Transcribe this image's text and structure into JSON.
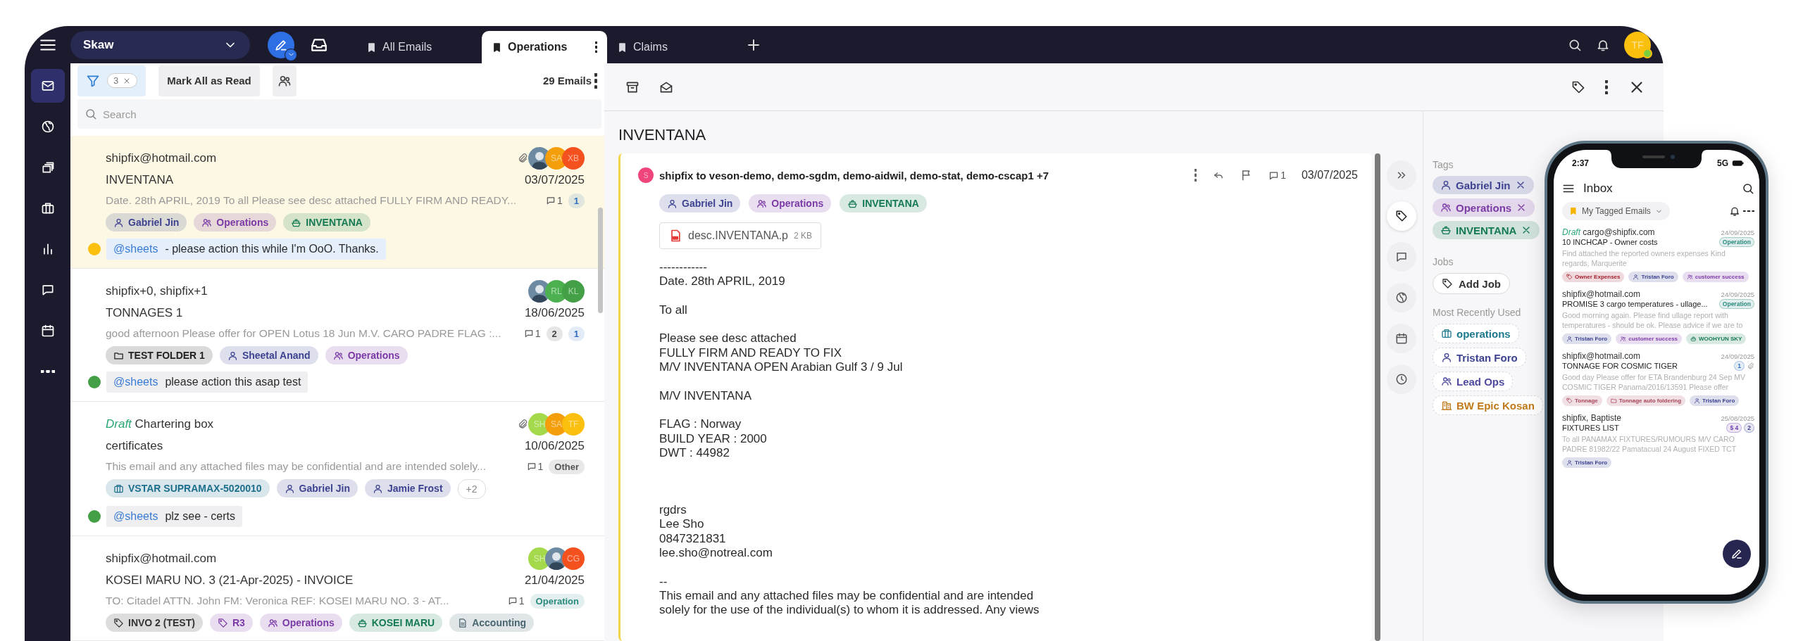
{
  "top_bar": {
    "workspace": "Skaw",
    "tabs": [
      {
        "label": "All Emails",
        "selected": false
      },
      {
        "label": "Operations",
        "selected": true
      },
      {
        "label": "Claims",
        "selected": false
      }
    ],
    "avatar": {
      "initials": "TF",
      "color": "#fbbf0e",
      "online": true
    }
  },
  "rail": {
    "items": [
      {
        "selected": true
      },
      {
        "selected": false
      },
      {
        "selected": false
      },
      {
        "selected": false
      },
      {
        "selected": false
      },
      {
        "selected": false
      },
      {
        "selected": false
      },
      {
        "selected": false
      }
    ]
  },
  "list": {
    "filter_count": "3",
    "mark_all": "Mark All as Read",
    "count": "29 Emails",
    "search": {
      "placeholder": "Search"
    },
    "emails": [
      {
        "selected": true,
        "from": "shipfix@hotmail.com",
        "attachment": true,
        "avatars": [
          {
            "kind": "photo"
          },
          {
            "kind": "initials",
            "initials": "SA",
            "color": "#f59e0b"
          },
          {
            "kind": "initials",
            "initials": "XB",
            "color": "#f4511e"
          }
        ],
        "subject": "INVENTANA",
        "date": "03/07/2025",
        "preview": "Date. 28th APRIL, 2019 To all Please see desc attached FULLY FIRM AND READY...",
        "comments": "1",
        "badges": [
          {
            "text": "1",
            "color": "#2f6fbd"
          }
        ],
        "tags": [
          {
            "kind": "person",
            "text": "Gabriel Jin",
            "color": "#3d4291"
          },
          {
            "kind": "group",
            "text": "Operations",
            "color": "#7b3aa6"
          },
          {
            "kind": "vessel",
            "text": "INVENTANA",
            "color": "#157a52"
          }
        ],
        "note": {
          "avatar": {
            "color": "#fbbf0e"
          },
          "mention": "@sheets",
          "text": "- please action this while I'm OoO. Thanks."
        }
      },
      {
        "selected": false,
        "from": "shipfix+0, shipfix+1",
        "attachment": false,
        "avatars": [
          {
            "kind": "photo"
          },
          {
            "kind": "initials",
            "initials": "RL",
            "color": "#4caf50"
          },
          {
            "kind": "initials",
            "initials": "KL",
            "color": "#43a047"
          }
        ],
        "subject": "TONNAGES 1",
        "date": "18/06/2025",
        "preview": "good afternoon Please offer for OPEN Lotus 18 Jun M.V. CARO PADRE FLAG :...",
        "comments": "1",
        "badges": [
          {
            "text": "2",
            "color": "#444444"
          },
          {
            "text": "1",
            "color": "#2f6fbd"
          }
        ],
        "tags": [
          {
            "kind": "folder",
            "text": "TEST FOLDER 1",
            "color": "#222222"
          },
          {
            "kind": "person",
            "text": "Sheetal Anand",
            "color": "#3d4291"
          },
          {
            "kind": "group",
            "text": "Operations",
            "color": "#7b3aa6"
          }
        ],
        "note": {
          "avatar": {
            "color": "#43a047"
          },
          "mention": "@sheets",
          "text": "please action this asap test"
        }
      },
      {
        "selected": false,
        "draft": "Draft",
        "from": "Chartering box",
        "attachment": true,
        "avatars": [
          {
            "kind": "initials",
            "initials": "SH",
            "color": "#a3d94a"
          },
          {
            "kind": "initials",
            "initials": "SA",
            "color": "#f59e0b"
          },
          {
            "kind": "initials",
            "initials": "TF",
            "color": "#fbbf0e"
          }
        ],
        "subject": "certificates",
        "date": "10/06/2025",
        "preview": "This email and any attached files may be confidential and are intended solely...",
        "comments": "1",
        "badges": [
          {
            "text": "Other",
            "color": "#555555"
          }
        ],
        "tags": [
          {
            "kind": "job",
            "text": "VSTAR SUPRAMAX-5020010",
            "color": "#1d6f8c"
          },
          {
            "kind": "person",
            "text": "Gabriel Jin",
            "color": "#3d4291"
          },
          {
            "kind": "person",
            "text": "Jamie Frost",
            "color": "#3d4291"
          },
          {
            "kind": "more",
            "text": "+2",
            "color": "#888888"
          }
        ],
        "note": {
          "avatar": {
            "color": "#43a047"
          },
          "mention": "@sheets",
          "text": "plz see - certs"
        }
      },
      {
        "selected": false,
        "from": "shipfix@hotmail.com",
        "attachment": false,
        "avatars": [
          {
            "kind": "initials",
            "initials": "SH",
            "color": "#a3d94a"
          },
          {
            "kind": "photo"
          },
          {
            "kind": "initials",
            "initials": "CG",
            "color": "#f4511e"
          }
        ],
        "subject": "KOSEI MARU NO. 3 (21-Apr-2025) - INVOICE",
        "date": "21/04/2025",
        "preview": "TO: Citadel ATTN. John FM: Veronica REF: KOSEI MARU NO. 3 - AT...",
        "comments": "1",
        "badges": [
          {
            "text": "Operation",
            "color": "#2a8a7e"
          }
        ],
        "tags": [
          {
            "kind": "label",
            "text": "INVO 2 (TEST)",
            "color": "#333333"
          },
          {
            "kind": "label",
            "text": "R3",
            "color": "#7b3aa6"
          },
          {
            "kind": "group",
            "text": "Operations",
            "color": "#7b3aa6"
          },
          {
            "kind": "vessel",
            "text": "KOSEI MARU",
            "color": "#157a52"
          },
          {
            "kind": "doc",
            "text": "Accounting",
            "color": "#4a6670"
          }
        ]
      }
    ]
  },
  "reader": {
    "subject": "INVENTANA",
    "message": {
      "avatar": {
        "initial": "S",
        "color": "#f0457a"
      },
      "header": "shipfix to veson-demo, demo-sgdm, demo-aidwil, demo-stat, demo-cscap1 +7",
      "comments": "1",
      "date": "03/07/2025",
      "tags": [
        {
          "kind": "person",
          "text": "Gabriel Jin",
          "color": "#3d4291"
        },
        {
          "kind": "group",
          "text": "Operations",
          "color": "#7b3aa6"
        },
        {
          "kind": "vessel",
          "text": "INVENTANA",
          "color": "#157a52"
        }
      ],
      "attachment": {
        "name": "desc.INVENTANA.p",
        "size": "2 KB"
      },
      "body": [
        {
          "spaced": false,
          "lines": [
            "------------",
            "Date. 28th APRIL, 2019"
          ]
        },
        {
          "spaced": false,
          "lines": [
            "To all"
          ]
        },
        {
          "spaced": false,
          "lines": [
            "Please see desc attached",
            "FULLY FIRM AND READY TO FIX",
            "M/V INVENTANA OPEN Arabian Gulf 3 / 9 Jul"
          ]
        },
        {
          "spaced": false,
          "lines": [
            "M/V INVENTANA"
          ]
        },
        {
          "spaced": false,
          "lines": [
            "FLAG : Norway",
            "BUILD YEAR : 2000",
            "DWT : 44982"
          ]
        },
        {
          "spaced": true,
          "lines": [
            "rgdrs",
            "Lee Sho",
            "0847321831",
            "lee.sho@notreal.com"
          ]
        },
        {
          "spaced": false,
          "lines": [
            "--",
            "This email and any attached files may be confidential and are intended",
            "solely for the use of the individual(s) to whom it is addressed. Any views"
          ]
        }
      ]
    },
    "side_buttons": [
      {
        "selected": false
      },
      {
        "selected": true
      },
      {
        "selected": false
      },
      {
        "selected": false
      },
      {
        "selected": false
      },
      {
        "selected": false
      }
    ]
  },
  "panel": {
    "tags_heading": "Tags",
    "tags": [
      {
        "kind": "person",
        "text": "Gabriel Jin",
        "color": "#3d4291"
      },
      {
        "kind": "group",
        "text": "Operations",
        "color": "#7b3aa6"
      },
      {
        "kind": "vessel",
        "text": "INVENTANA",
        "color": "#157a52"
      }
    ],
    "jobs_heading": "Jobs",
    "add_job": "Add Job",
    "recent_heading": "Most Recently Used",
    "recent": [
      {
        "kind": "job",
        "text": "operations",
        "color": "#1d7a8c"
      },
      {
        "kind": "person",
        "text": "Tristan Foro",
        "color": "#3d4291"
      },
      {
        "kind": "group",
        "text": "Lead Ops",
        "color": "#4f4aa0"
      },
      {
        "kind": "company",
        "text": "BW Epic Kosan",
        "color": "#c07a1a"
      }
    ]
  },
  "phone": {
    "time": "2:37",
    "network": "5G",
    "title": "Inbox",
    "filter": "My Tagged Emails",
    "emails": [
      {
        "draft": "Draft",
        "from": "cargo@shipfix.com",
        "date": "24/09/2025",
        "subject": "10 INCHCAP - Owner costs",
        "attachment": false,
        "badges": [
          {
            "text": "Operation",
            "color": "#2a8a7e"
          }
        ],
        "preview": "Find attached the reported owners expenses Kind regards, Marquerite",
        "tags": [
          {
            "kind": "label",
            "text": "Owner Expenses",
            "color": "#a3202f"
          },
          {
            "kind": "person",
            "text": "Tristan Foro",
            "color": "#3d4291"
          },
          {
            "kind": "group",
            "text": "customer success",
            "color": "#7b3aa6"
          }
        ]
      },
      {
        "from": "shipfix@hotmail.com",
        "date": "24/09/2025",
        "subject": "PROMISE 3 cargo temperatures - ullage...",
        "attachment": false,
        "badges": [
          {
            "text": "Operation",
            "color": "#2a8a7e"
          }
        ],
        "preview": "Good morning again. Please find ullage report with temperatures - should be ok. Please advice if we are to",
        "tags": [
          {
            "kind": "person",
            "text": "Tristan Foro",
            "color": "#3d4291"
          },
          {
            "kind": "group",
            "text": "customer success",
            "color": "#7b3aa6"
          },
          {
            "kind": "vessel",
            "text": "WOOHYUN SKY",
            "color": "#157a52"
          }
        ]
      },
      {
        "from": "shipfix@hotmail.com",
        "date": "24/09/2025",
        "subject": "TONNAGE FOR COSMIC TIGER",
        "attachment": true,
        "badges": [
          {
            "text": "1",
            "color": "#2f6fbd"
          }
        ],
        "preview": "Good day Please offer for ETA Brandenburg 24 Sep MV COSMIC TIGER Panama/2016/13591 Please offer",
        "tags": [
          {
            "kind": "label",
            "text": "Tonnage",
            "color": "#a8445a"
          },
          {
            "kind": "folder",
            "text": "Tonnage auto foldering",
            "color": "#a8445a"
          },
          {
            "kind": "person",
            "text": "Tristan Foro",
            "color": "#3d4291"
          }
        ]
      },
      {
        "from": "shipfix, Baptiste",
        "date": "25/08/2025",
        "subject": "FIXTURES LIST",
        "attachment": false,
        "badges": [
          {
            "text": "$ 4",
            "color": "#6b3fb0"
          },
          {
            "text": "2",
            "color": "#3d4291"
          }
        ],
        "preview": "To all PANAMAX FIXTURES/RUMOURS M/V CARO PADRE 81982/22 Pamatacual 24 August FIXED TCT",
        "tags": [
          {
            "kind": "person",
            "text": "Tristan Foro",
            "color": "#3d4291"
          }
        ]
      }
    ]
  }
}
